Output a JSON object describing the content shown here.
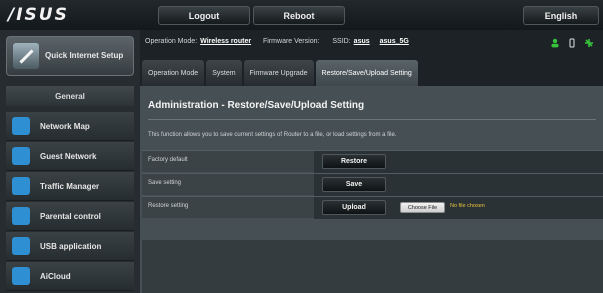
{
  "topbar": {
    "logo": "/ISUS",
    "logout_label": "Logout",
    "reboot_label": "Reboot",
    "language_label": "English"
  },
  "sidebar": {
    "quick_setup": "Quick Internet Setup",
    "section_label": "General",
    "items": [
      {
        "label": "Network Map",
        "icon": "network-map-icon",
        "color": "#2f8fd3"
      },
      {
        "label": "Guest Network",
        "icon": "guest-network-icon",
        "color": "#2f8fd3"
      },
      {
        "label": "Traffic Manager",
        "icon": "traffic-manager-icon",
        "color": "#2f8fd3"
      },
      {
        "label": "Parental control",
        "icon": "lock-icon",
        "color": "#2f8fd3"
      },
      {
        "label": "USB application",
        "icon": "usb-icon",
        "color": "#2f8fd3"
      },
      {
        "label": "AiCloud",
        "icon": "cloud-icon",
        "color": "#2f8fd3"
      }
    ]
  },
  "status": {
    "mode_label": "Operation Mode:",
    "mode_value": "Wireless router",
    "firmware_label": "Firmware Version:",
    "ssid_label": "SSID:",
    "ssid_value_1": "asus",
    "ssid_value_2": "asus_5G"
  },
  "tabs": [
    {
      "label": "Operation Mode",
      "active": false
    },
    {
      "label": "System",
      "active": false
    },
    {
      "label": "Firmware Upgrade",
      "active": false
    },
    {
      "label": "Restore/Save/Upload Setting",
      "active": true
    }
  ],
  "content": {
    "title": "Administration - Restore/Save/Upload Setting",
    "description": "This function allows you to save current settings of Router to a file, or load settings from a file.",
    "rows": [
      {
        "label": "Factory default",
        "button": "Restore"
      },
      {
        "label": "Save setting",
        "button": "Save"
      },
      {
        "label": "Restore setting",
        "button": "Upload",
        "file_button": "Choose File",
        "file_status": "No file chosen"
      }
    ]
  },
  "colors": {
    "accent": "#2f8fd3",
    "status_icon_green": "#36c23a",
    "file_status_text": "#e6c33e"
  }
}
